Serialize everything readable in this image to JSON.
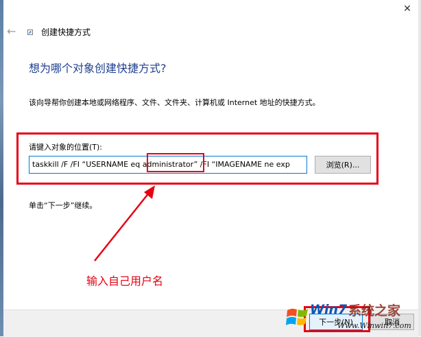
{
  "window": {
    "close_glyph": "✕"
  },
  "wizard": {
    "back_glyph": "←",
    "title": "创建快捷方式",
    "heading": "想为哪个对象创建快捷方式?",
    "description": "该向导帮你创建本地或网络程序、文件、文件夹、计算机或 Internet 地址的快捷方式。",
    "location_label": "请键入对象的位置(T):",
    "location_value": "taskkill /F /FI “USERNAME eq administrator” /FI “IMAGENAME ne exp",
    "browse_label": "浏览(R)...",
    "instruction": "单击“下一步”继续。"
  },
  "footer": {
    "next_label": "下一步(N)",
    "cancel_label": "取消"
  },
  "annotation": {
    "text": "输入自己用户名",
    "color": "#e60012"
  },
  "watermark": {
    "brand": "Win7",
    "cn": "系统之家",
    "url": "Www.Winwin7.com"
  },
  "colors": {
    "heading": "#1f3f8f",
    "accent": "#0078d7"
  }
}
